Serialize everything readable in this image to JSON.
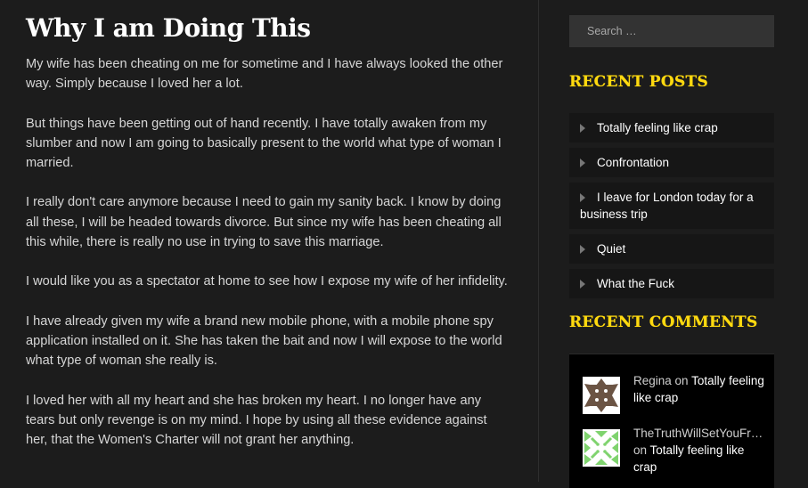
{
  "post": {
    "title": "Why I am Doing This",
    "paragraphs": [
      "My wife has been cheating on me for sometime and I have always looked the other way.  Simply because I loved her a lot.",
      "But things have been getting out of hand recently.  I have totally awaken from my slumber and now I am going to basically present to the world what type of woman I married.",
      "I really don't care anymore because I need to gain my sanity back.  I know by doing all these, I will be headed towards divorce.  But since my wife has been cheating all this while, there is really no use in trying to save this marriage.",
      "I would like you as a spectator at home to see how I expose my wife of her infidelity.",
      "I have already given my wife a brand new mobile phone, with a mobile phone spy application installed on it.  She has taken the bait and now I will expose to the world what type of woman she really is.",
      "I loved her with all my heart and she has broken my heart.  I no longer have any tears but only revenge is on my mind.  I hope by using all these evidence against her, that the Women's Charter will not grant her anything."
    ]
  },
  "sidebar": {
    "search": {
      "placeholder": "Search …",
      "value": ""
    },
    "recent_posts": {
      "title": "RECENT POSTS",
      "items": [
        {
          "label": "Totally feeling like crap",
          "icon": "caret-right-icon"
        },
        {
          "label": "Confrontation",
          "icon": "caret-right-icon"
        },
        {
          "label": "I leave for London today for a business trip",
          "icon": "caret-right-icon"
        },
        {
          "label": "Quiet",
          "icon": "caret-right-icon"
        },
        {
          "label": "What the Fuck",
          "icon": "caret-right-icon"
        }
      ]
    },
    "recent_comments": {
      "title": "RECENT COMMENTS",
      "items": [
        {
          "author": "Regina",
          "connector": "on",
          "post": "Totally feeling like crap",
          "avatar_color": "#6b5444"
        },
        {
          "author": "TheTruthWillSetYouFr…",
          "connector": "on",
          "post": "Totally feeling like crap",
          "avatar_color": "#7fd36e"
        }
      ]
    }
  },
  "colors": {
    "background": "#1c1c1c",
    "accent": "#ffd90f",
    "text": "#d6d6d6"
  }
}
